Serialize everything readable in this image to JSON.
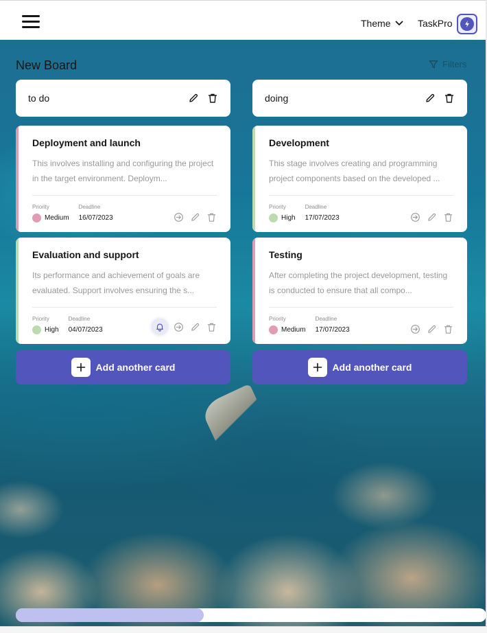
{
  "header": {
    "theme_label": "Theme",
    "username": "TaskPro"
  },
  "board": {
    "title": "New Board",
    "filters_label": "Filters"
  },
  "meta_labels": {
    "priority": "Priority",
    "deadline": "Deadline"
  },
  "colors": {
    "accent": "#5255BC",
    "priority_medium": "#E09CB5",
    "priority_high": "#BEDBB0"
  },
  "columns": [
    {
      "title": "to do",
      "cards": [
        {
          "title": "Deployment and launch",
          "description": "This involves installing and configuring the project in the target environment. Deploym...",
          "priority": "Medium",
          "deadline": "16/07/2023",
          "has_bell": false
        },
        {
          "title": "Evaluation and support",
          "description": "Its performance and achievement of goals are evaluated. Support involves ensuring the s...",
          "priority": "High",
          "deadline": "04/07/2023",
          "has_bell": true
        }
      ],
      "add_label": "Add another card"
    },
    {
      "title": "doing",
      "cards": [
        {
          "title": "Development",
          "description": "This stage involves creating and programming project components based on the developed ...",
          "priority": "High",
          "deadline": "17/07/2023",
          "has_bell": false
        },
        {
          "title": "Testing",
          "description": "After completing the project development, testing is conducted to ensure that all compo...",
          "priority": "Medium",
          "deadline": "17/07/2023",
          "has_bell": false
        }
      ],
      "add_label": "Add another card"
    }
  ],
  "scrollbar": {
    "thumb_fraction": 0.4
  }
}
